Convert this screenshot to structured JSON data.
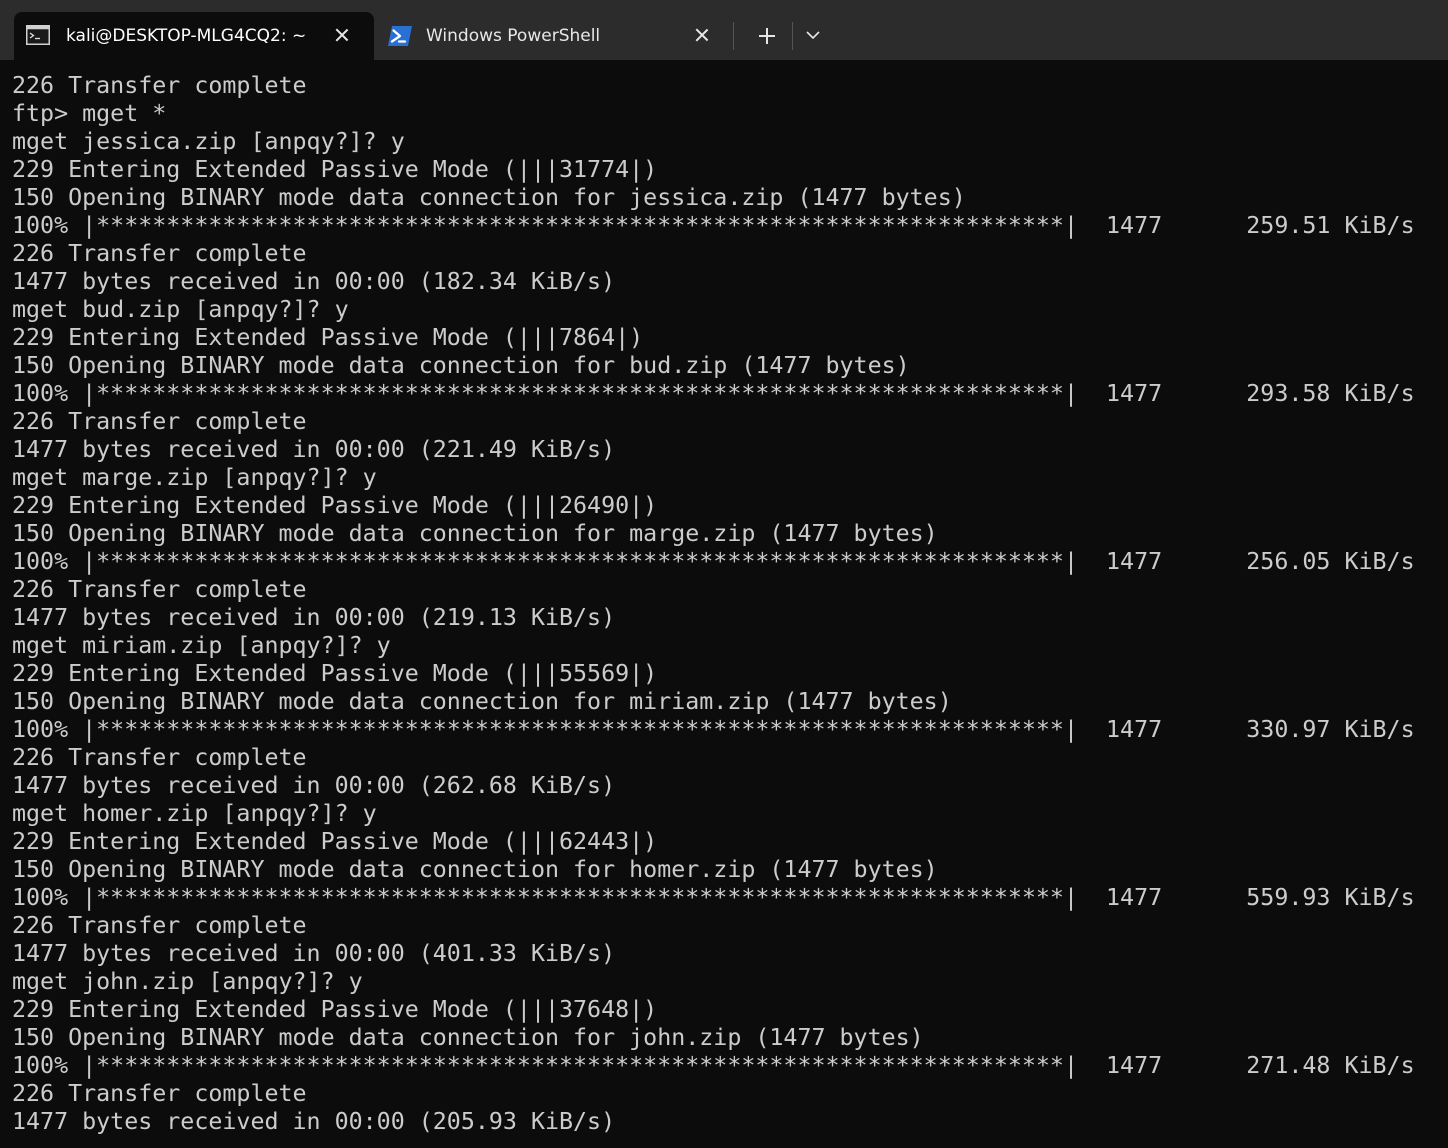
{
  "tabs": [
    {
      "title": "kali@DESKTOP-MLG4CQ2: ~",
      "icon": "terminal-icon",
      "active": true
    },
    {
      "title": "Windows PowerShell",
      "icon": "powershell-icon",
      "active": false
    }
  ],
  "terminal": {
    "lines": [
      "226 Transfer complete",
      "ftp> mget *",
      "mget jessica.zip [anpqy?]? y",
      "229 Entering Extended Passive Mode (|||31774|)",
      "150 Opening BINARY mode data connection for jessica.zip (1477 bytes)",
      "100% |*********************************************************************|  1477      259.51 KiB/s",
      "226 Transfer complete",
      "1477 bytes received in 00:00 (182.34 KiB/s)",
      "mget bud.zip [anpqy?]? y",
      "229 Entering Extended Passive Mode (|||7864|)",
      "150 Opening BINARY mode data connection for bud.zip (1477 bytes)",
      "100% |*********************************************************************|  1477      293.58 KiB/s",
      "226 Transfer complete",
      "1477 bytes received in 00:00 (221.49 KiB/s)",
      "mget marge.zip [anpqy?]? y",
      "229 Entering Extended Passive Mode (|||26490|)",
      "150 Opening BINARY mode data connection for marge.zip (1477 bytes)",
      "100% |*********************************************************************|  1477      256.05 KiB/s",
      "226 Transfer complete",
      "1477 bytes received in 00:00 (219.13 KiB/s)",
      "mget miriam.zip [anpqy?]? y",
      "229 Entering Extended Passive Mode (|||55569|)",
      "150 Opening BINARY mode data connection for miriam.zip (1477 bytes)",
      "100% |*********************************************************************|  1477      330.97 KiB/s",
      "226 Transfer complete",
      "1477 bytes received in 00:00 (262.68 KiB/s)",
      "mget homer.zip [anpqy?]? y",
      "229 Entering Extended Passive Mode (|||62443|)",
      "150 Opening BINARY mode data connection for homer.zip (1477 bytes)",
      "100% |*********************************************************************|  1477      559.93 KiB/s",
      "226 Transfer complete",
      "1477 bytes received in 00:00 (401.33 KiB/s)",
      "mget john.zip [anpqy?]? y",
      "229 Entering Extended Passive Mode (|||37648|)",
      "150 Opening BINARY mode data connection for john.zip (1477 bytes)",
      "100% |*********************************************************************|  1477      271.48 KiB/s",
      "226 Transfer complete",
      "1477 bytes received in 00:00 (205.93 KiB/s)"
    ]
  },
  "colors": {
    "terminal_bg": "#0c0c0c",
    "terminal_fg": "#cccccc",
    "tabbar_bg": "#2c2c2c",
    "powershell_blue": "#2a6fd4"
  }
}
